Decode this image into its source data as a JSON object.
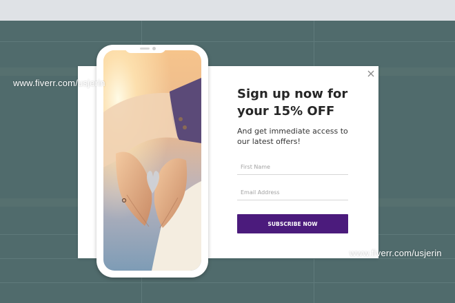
{
  "popup": {
    "headline": "Sign up now for your 15% OFF",
    "subtext": "And get immediate access to our latest offers!",
    "first_name_placeholder": "First Name",
    "email_placeholder": "Email Address",
    "subscribe_label": "SUBSCRIBE NOW",
    "close_icon": "close-icon",
    "image_subject": "hands forming a heart shape against the sunset"
  },
  "watermarks": [
    "www.fiverr.com/usjerin",
    "www.fiverr.com/usjerin"
  ],
  "colors": {
    "button": "#4b1b7c",
    "backdrop": "#506b6c",
    "topbar": "#dfe2e6",
    "headline": "#262626"
  }
}
